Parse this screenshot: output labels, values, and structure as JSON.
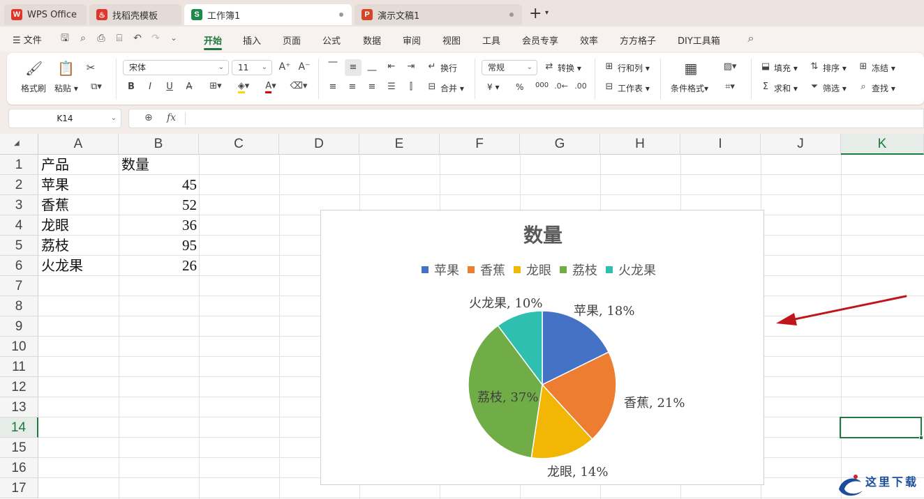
{
  "tabs": [
    {
      "label": "WPS Office",
      "icon": "wps-logo-icon",
      "color": "#e0352b"
    },
    {
      "label": "找稻壳模板",
      "icon": "docer-icon",
      "color": "#e0352b"
    },
    {
      "label": "工作簿1",
      "icon": "spreadsheet-icon",
      "color": "#1c8a4a",
      "icon_text": "S"
    },
    {
      "label": "演示文稿1",
      "icon": "presentation-icon",
      "color": "#d24726",
      "icon_text": "P"
    }
  ],
  "menu": {
    "file": "文件",
    "items": [
      "开始",
      "插入",
      "页面",
      "公式",
      "数据",
      "审阅",
      "视图",
      "工具",
      "会员专享",
      "效率",
      "方方格子",
      "DIY工具箱"
    ],
    "active": "开始"
  },
  "ribbon": {
    "format_painter": "格式刷",
    "paste": "粘贴",
    "font_name": "宋体",
    "font_size": "11",
    "wrap": "换行",
    "merge": "合并",
    "number_format": "常规",
    "convert": "转换",
    "row_col": "行和列",
    "worksheet": "工作表",
    "cond_format": "条件格式",
    "fill": "填充",
    "sort": "排序",
    "freeze": "冻结",
    "sum": "求和",
    "filter": "筛选",
    "find": "查找",
    "currency": "¥",
    "percent": "%",
    "thousands": "000"
  },
  "formula_bar": {
    "name_box": "K14",
    "fx": "fx",
    "value": ""
  },
  "grid": {
    "columns": [
      "A",
      "B",
      "C",
      "D",
      "E",
      "F",
      "G",
      "H",
      "I",
      "J",
      "K"
    ],
    "rows": [
      "1",
      "2",
      "3",
      "4",
      "5",
      "6",
      "7",
      "8",
      "9",
      "10",
      "11",
      "12",
      "13",
      "14",
      "15",
      "16",
      "17"
    ],
    "selected_cell": "K14",
    "cells": [
      [
        "产品",
        "数量"
      ],
      [
        "苹果",
        "45"
      ],
      [
        "香蕉",
        "52"
      ],
      [
        "龙眼",
        "36"
      ],
      [
        "荔枝",
        "95"
      ],
      [
        "火龙果",
        "26"
      ]
    ]
  },
  "chart_data": {
    "type": "pie",
    "title": "数量",
    "categories": [
      "苹果",
      "香蕉",
      "龙眼",
      "荔枝",
      "火龙果"
    ],
    "values": [
      45,
      52,
      36,
      95,
      26
    ],
    "labels": [
      "苹果, 18%",
      "香蕉, 21%",
      "龙眼, 14%",
      "荔枝, 37%",
      "火龙果, 10%"
    ],
    "colors": [
      "#4472c4",
      "#ed7d31",
      "#f2b705",
      "#70ad47",
      "#2ebfb0"
    ],
    "legend": "top"
  },
  "watermark": "这里下载",
  "accent_color": "#1c7a3e"
}
